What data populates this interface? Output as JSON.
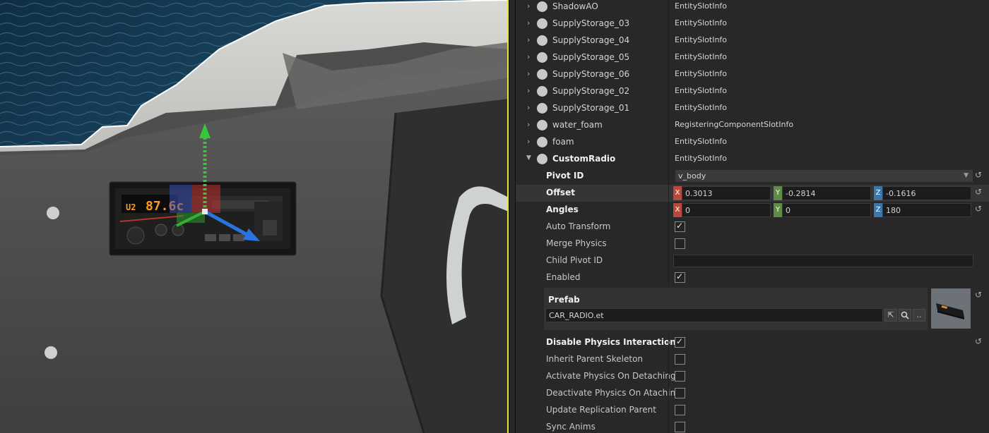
{
  "viewport": {
    "radio_display_left": "U2",
    "radio_display_right": "87.6c"
  },
  "entities": [
    {
      "name": "ShadowAO",
      "type": "EntitySlotInfo"
    },
    {
      "name": "SupplyStorage_03",
      "type": "EntitySlotInfo"
    },
    {
      "name": "SupplyStorage_04",
      "type": "EntitySlotInfo"
    },
    {
      "name": "SupplyStorage_05",
      "type": "EntitySlotInfo"
    },
    {
      "name": "SupplyStorage_06",
      "type": "EntitySlotInfo"
    },
    {
      "name": "SupplyStorage_02",
      "type": "EntitySlotInfo"
    },
    {
      "name": "SupplyStorage_01",
      "type": "EntitySlotInfo"
    },
    {
      "name": "water_foam",
      "type": "RegisteringComponentSlotInfo"
    },
    {
      "name": "foam",
      "type": "EntitySlotInfo"
    },
    {
      "name": "CustomRadio",
      "type": "EntitySlotInfo"
    }
  ],
  "props": {
    "pivot_id_label": "Pivot ID",
    "pivot_id_value": "v_body",
    "offset_label": "Offset",
    "offset": {
      "x": "0.3013",
      "y": "-0.2814",
      "z": "-0.1616"
    },
    "angles_label": "Angles",
    "angles": {
      "x": "0",
      "y": "0",
      "z": "180"
    },
    "axis": {
      "x": "X",
      "y": "Y",
      "z": "Z"
    },
    "auto_transform_label": "Auto Transform",
    "merge_physics_label": "Merge Physics",
    "child_pivot_label": "Child Pivot ID",
    "child_pivot_value": "",
    "enabled_label": "Enabled",
    "prefab_label": "Prefab",
    "prefab_value": "CAR_RADIO.et",
    "prefab_more": "..",
    "disable_physics_label": "Disable Physics Interaction",
    "inherit_skeleton_label": "Inherit Parent Skeleton",
    "activate_physics_label": "Activate Physics On Detaching",
    "deactivate_physics_label": "Deactivate Physics On Ataching",
    "update_replication_label": "Update Replication Parent",
    "sync_anims_label": "Sync Anims"
  },
  "checks": {
    "auto_transform": true,
    "merge_physics": false,
    "enabled": true,
    "disable_physics": true,
    "inherit_skeleton": false,
    "activate_physics": false,
    "deactivate_physics": false,
    "update_replication": false,
    "sync_anims": false
  },
  "colors": {
    "axis_x": "#b84a3c",
    "axis_y": "#5f8a48",
    "axis_z": "#3d77a8",
    "radio_display": "#ff9a1e",
    "viewport_border": "#e8e43a"
  }
}
